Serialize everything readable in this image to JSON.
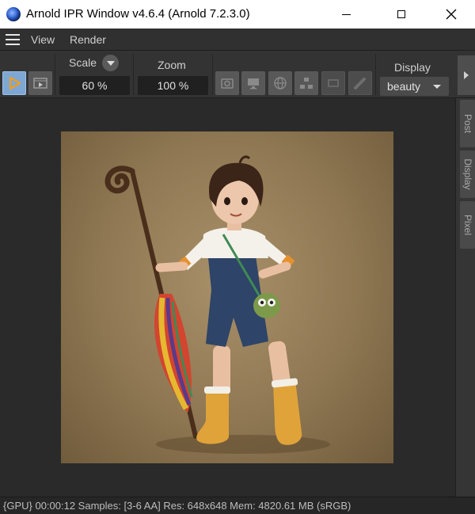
{
  "window": {
    "title": "Arnold IPR Window v4.6.4 (Arnold 7.2.3.0)"
  },
  "menu": {
    "items": [
      "View",
      "Render"
    ]
  },
  "toolbar": {
    "scale_label": "Scale",
    "scale_value": "60 %",
    "zoom_label": "Zoom",
    "zoom_value": "100 %",
    "display_label": "Display",
    "display_value": "beauty"
  },
  "side_tabs": [
    "Post",
    "Display",
    "Pixel"
  ],
  "status": {
    "text": "{GPU} 00:00:12  Samples: [3-6 AA]  Res: 648x648  Mem: 4820.61 MB  (sRGB)"
  },
  "colors": {
    "accent": "#7ea7d4",
    "render_button": "#ff9d00",
    "background": "#2b2b2b"
  }
}
